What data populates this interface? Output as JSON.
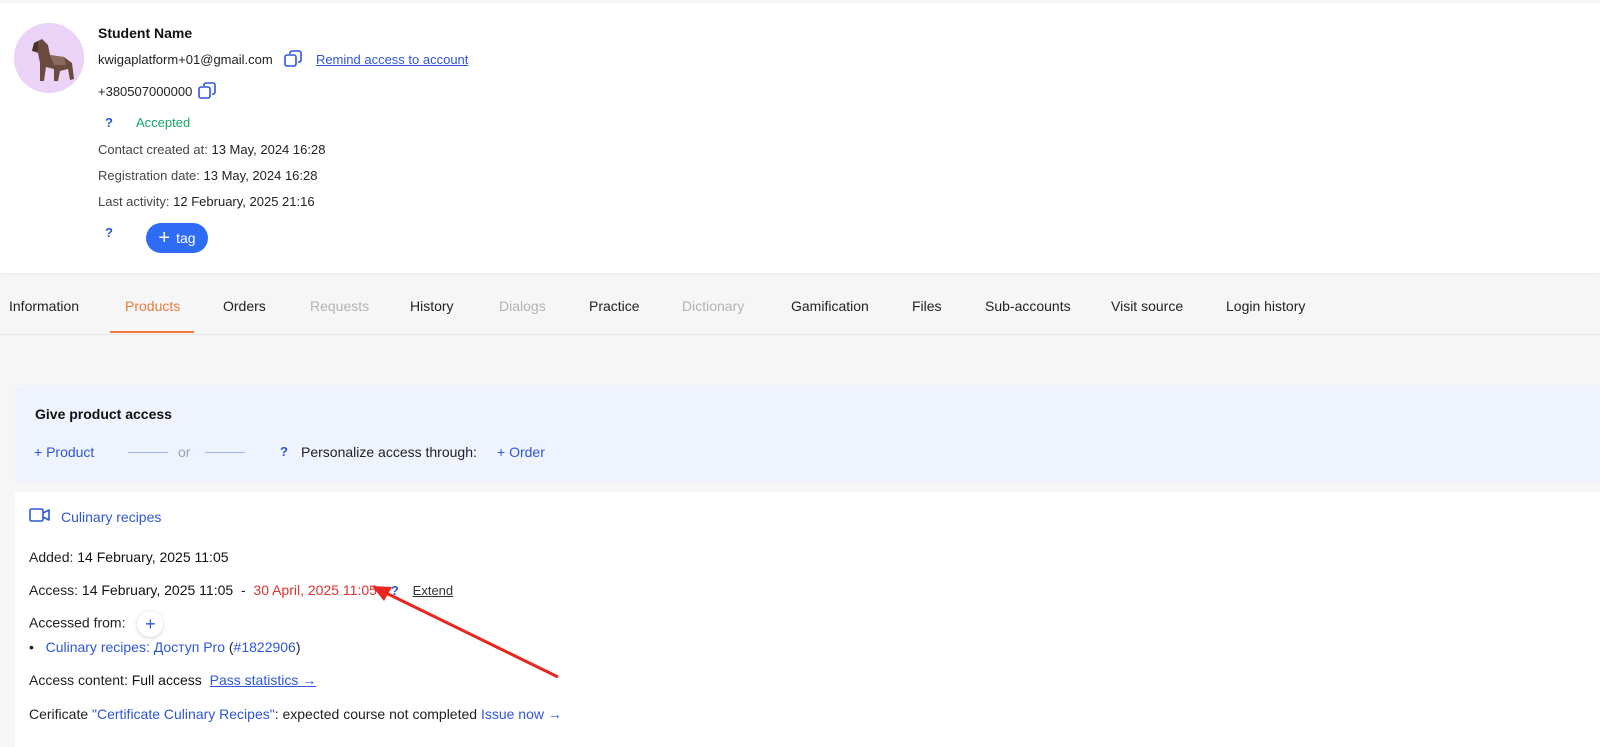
{
  "profile": {
    "name": "Student Name",
    "email": "kwigaplatform+01@gmail.com",
    "remind_link": "Remind access to account",
    "phone": "+380507000000",
    "help_mark": "?",
    "status": "Accepted",
    "contact_created_label": "Contact created at:",
    "contact_created_value": "13 May, 2024 16:28",
    "registration_label": "Registration date:",
    "registration_value": "13 May, 2024 16:28",
    "last_activity_label": "Last activity:",
    "last_activity_value": "12 February, 2025 21:16",
    "tag_button": "tag"
  },
  "tabs": [
    {
      "label": "Information"
    },
    {
      "label": "Products"
    },
    {
      "label": "Orders"
    },
    {
      "label": "Requests"
    },
    {
      "label": "History"
    },
    {
      "label": "Dialogs"
    },
    {
      "label": "Practice"
    },
    {
      "label": "Dictionary"
    },
    {
      "label": "Gamification"
    },
    {
      "label": "Files"
    },
    {
      "label": "Sub-accounts"
    },
    {
      "label": "Visit source"
    },
    {
      "label": "Login history"
    }
  ],
  "give_access": {
    "title": "Give product access",
    "add_product": "+ Product",
    "or": "or",
    "personalize": "Personalize access through:",
    "add_order": "+ Order"
  },
  "product": {
    "title": "Culinary recipes",
    "added_label": "Added:",
    "added_value": "14 February, 2025 11:05",
    "access_label": "Access:",
    "access_from": "14 February, 2025 11:05",
    "dash": "-",
    "access_to": "30 April, 2025 11:05",
    "extend": "Extend",
    "accessed_from_label": "Accessed from:",
    "source_name": "Culinary recipes: Доступ Pro",
    "source_id": "#1822906",
    "access_content_label": "Access content:",
    "access_content_value": "Full access",
    "pass_statistics": "Pass statistics →",
    "certificate_prefix": "Cerificate",
    "certificate_name": "\"Certificate Culinary Recipes\"",
    "certificate_status": ": expected course not completed",
    "issue_now": "Issue now →"
  },
  "colors": {
    "accent": "#2f56d6",
    "tab_active": "#f07a3a",
    "status_green": "#16a36a",
    "expiry_red": "#e0322f",
    "tag_button": "#2f6cf6"
  }
}
